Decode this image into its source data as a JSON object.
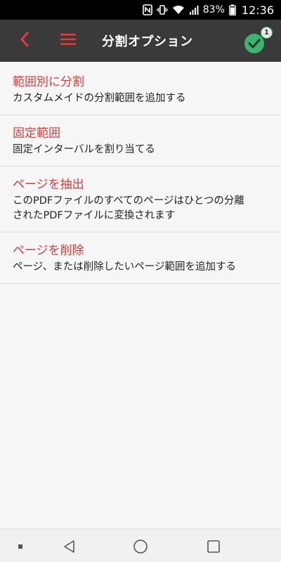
{
  "status_bar": {
    "battery": "83%",
    "time": "12:36",
    "icons": [
      "nfc-icon",
      "vibrate-icon",
      "wifi-icon",
      "signal-icon",
      "battery-icon"
    ]
  },
  "app_bar": {
    "title": "分割オプション",
    "back_icon": "chevron-left-icon",
    "menu_icon": "hamburger-menu-icon",
    "done_icon": "check-circle-icon",
    "badge_count": "1",
    "accent_color": "#d83b3b",
    "confirm_color": "#3cb46e"
  },
  "options": [
    {
      "title": "範囲別に分割",
      "desc_lines": [
        "カスタムメイドの分割範囲を追加する"
      ]
    },
    {
      "title": "固定範囲",
      "desc_lines": [
        "固定インターバルを割り当てる"
      ]
    },
    {
      "title": "ページを抽出",
      "desc_lines": [
        "このPDFファイルのすべてのページはひとつの分離",
        "されたPDFファイルに変換されます"
      ]
    },
    {
      "title": "ページを削除",
      "desc_lines": [
        "ページ、または削除したいページ範囲を追加する"
      ]
    }
  ],
  "nav_bar": {
    "icons": [
      "recent-dot-icon",
      "back-triangle-icon",
      "home-circle-icon",
      "overview-square-icon"
    ]
  }
}
